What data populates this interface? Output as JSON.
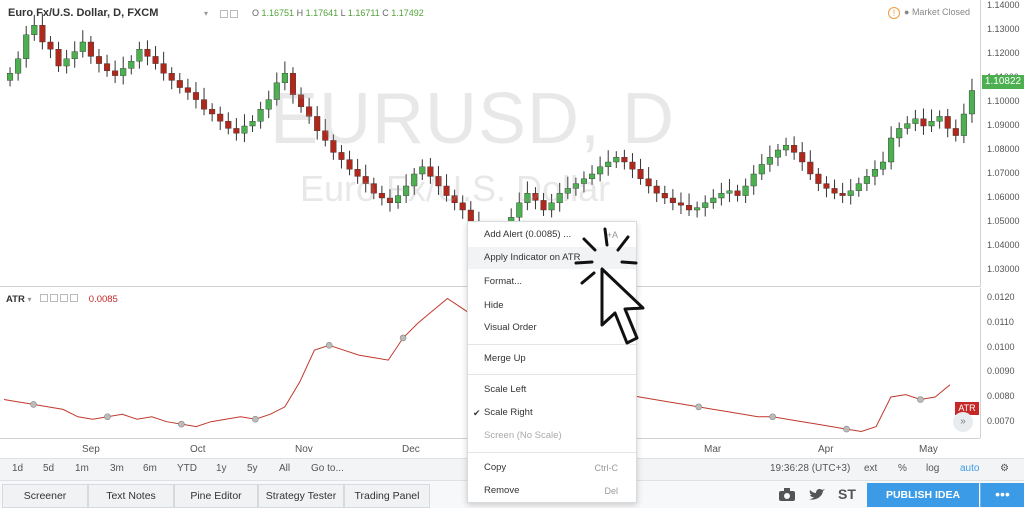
{
  "legend": {
    "symbol": "Euro Fx/U.S. Dollar, D, FXCM",
    "o_label": "O",
    "o": "1.16751",
    "h_label": "H",
    "h": "1.17641",
    "l_label": "L",
    "l": "1.16711",
    "c_label": "C",
    "c": "1.17492"
  },
  "status": {
    "market": "Market Closed",
    "warning": "!"
  },
  "watermark": {
    "main": "EURUSD, D",
    "sub": "Euro Fx/U.S. Dollar"
  },
  "price_axis": {
    "ticks": [
      "1.14000",
      "1.13000",
      "1.12000",
      "1.11000",
      "1.10000",
      "1.09000",
      "1.08000",
      "1.07000",
      "1.06000",
      "1.05000",
      "1.04000",
      "1.03000"
    ],
    "last_price": "1.10822",
    "last_color": "#4caf50"
  },
  "atr": {
    "name": "ATR",
    "value": "0.0085",
    "axis_ticks": [
      "0.0120",
      "0.0110",
      "0.0100",
      "0.0090",
      "0.0080",
      "0.0070"
    ],
    "badge": "ATR",
    "color": "#c62828"
  },
  "time_axis": {
    "months": [
      "Sep",
      "Oct",
      "Nov",
      "Dec",
      "Mar",
      "Apr",
      "May"
    ]
  },
  "toolbar": {
    "ranges": [
      "1d",
      "5d",
      "1m",
      "3m",
      "6m",
      "YTD",
      "1y",
      "5y",
      "All",
      "Go to..."
    ],
    "clock": "19:36:28 (UTC+3)",
    "right": [
      "ext",
      "%",
      "log",
      "auto"
    ],
    "gear": "⚙"
  },
  "bottom_tabs": [
    "Screener",
    "Text Notes",
    "Pine Editor",
    "Strategy Tester",
    "Trading Panel"
  ],
  "bottom_icons": {
    "st": "ST"
  },
  "publish": "PUBLISH IDEA",
  "more": "•••",
  "collapse": "»",
  "context_menu": {
    "items": [
      {
        "label": "Add Alert (0.0085) ...",
        "shortcut": "+A"
      },
      {
        "label": "Apply Indicator on ATR",
        "shortcut": ""
      },
      {
        "label": "Format...",
        "shortcut": ""
      },
      {
        "label": "Hide",
        "shortcut": ""
      },
      {
        "label": "Visual Order",
        "shortcut": ""
      },
      {
        "label": "Merge Up",
        "shortcut": ""
      },
      {
        "label": "Scale Left",
        "shortcut": ""
      },
      {
        "label": "Scale Right",
        "shortcut": "",
        "check": "✔"
      },
      {
        "label": "Screen (No Scale)",
        "shortcut": ""
      },
      {
        "label": "Copy",
        "shortcut": "Ctrl-C"
      },
      {
        "label": "Remove",
        "shortcut": "Del"
      }
    ]
  },
  "colors": {
    "up": "#4caf50",
    "down": "#b0281c",
    "atr_line": "#c0392b",
    "accent": "#3c9be6"
  },
  "chart_data": {
    "type": "candlestick",
    "title": "Euro Fx/U.S. Dollar, D, FXCM",
    "ylim": [
      1.03,
      1.14
    ],
    "x": [
      "Sep",
      "Oct",
      "Nov",
      "Dec",
      "Mar",
      "Apr",
      "May"
    ],
    "closes": [
      1.112,
      1.118,
      1.128,
      1.132,
      1.125,
      1.122,
      1.115,
      1.118,
      1.121,
      1.125,
      1.119,
      1.116,
      1.113,
      1.111,
      1.114,
      1.117,
      1.122,
      1.119,
      1.116,
      1.112,
      1.109,
      1.106,
      1.104,
      1.101,
      1.097,
      1.095,
      1.092,
      1.089,
      1.087,
      1.09,
      1.092,
      1.097,
      1.101,
      1.108,
      1.112,
      1.103,
      1.098,
      1.094,
      1.088,
      1.084,
      1.079,
      1.076,
      1.072,
      1.069,
      1.066,
      1.062,
      1.06,
      1.058,
      1.061,
      1.065,
      1.07,
      1.073,
      1.069,
      1.065,
      1.061,
      1.058,
      1.055,
      1.05,
      1.045,
      1.042,
      1.038,
      1.043,
      1.052,
      1.058,
      1.062,
      1.059,
      1.055,
      1.058,
      1.062,
      1.064,
      1.066,
      1.068,
      1.07,
      1.073,
      1.075,
      1.077,
      1.075,
      1.072,
      1.068,
      1.065,
      1.062,
      1.06,
      1.058,
      1.057,
      1.055,
      1.056,
      1.058,
      1.06,
      1.062,
      1.063,
      1.061,
      1.065,
      1.07,
      1.074,
      1.077,
      1.08,
      1.082,
      1.079,
      1.075,
      1.07,
      1.066,
      1.064,
      1.062,
      1.061,
      1.063,
      1.066,
      1.069,
      1.072,
      1.075,
      1.085,
      1.089,
      1.091,
      1.093,
      1.09,
      1.092,
      1.094,
      1.089,
      1.086,
      1.095,
      1.1048
    ],
    "atr_values": [
      0.0079,
      0.0078,
      0.0077,
      0.0076,
      0.0075,
      0.0072,
      0.0071,
      0.0072,
      0.0073,
      0.0071,
      0.0072,
      0.007,
      0.0069,
      0.0068,
      0.007,
      0.0071,
      0.0072,
      0.0071,
      0.0073,
      0.0076,
      0.0086,
      0.0099,
      0.0101,
      0.0099,
      0.0097,
      0.0096,
      0.0095,
      0.0104,
      0.011,
      0.0115,
      0.012,
      0.0116,
      0.0112,
      0.0108,
      0.0102,
      0.0098,
      0.0094,
      0.009,
      0.0088,
      0.0086,
      0.0084,
      0.0082,
      0.0081,
      0.008,
      0.0079,
      0.0078,
      0.0077,
      0.0076,
      0.0075,
      0.0074,
      0.0073,
      0.0072,
      0.0072,
      0.0071,
      0.007,
      0.0069,
      0.0068,
      0.0067,
      0.0066,
      0.0068,
      0.008,
      0.0081,
      0.0079,
      0.008,
      0.0085
    ]
  }
}
